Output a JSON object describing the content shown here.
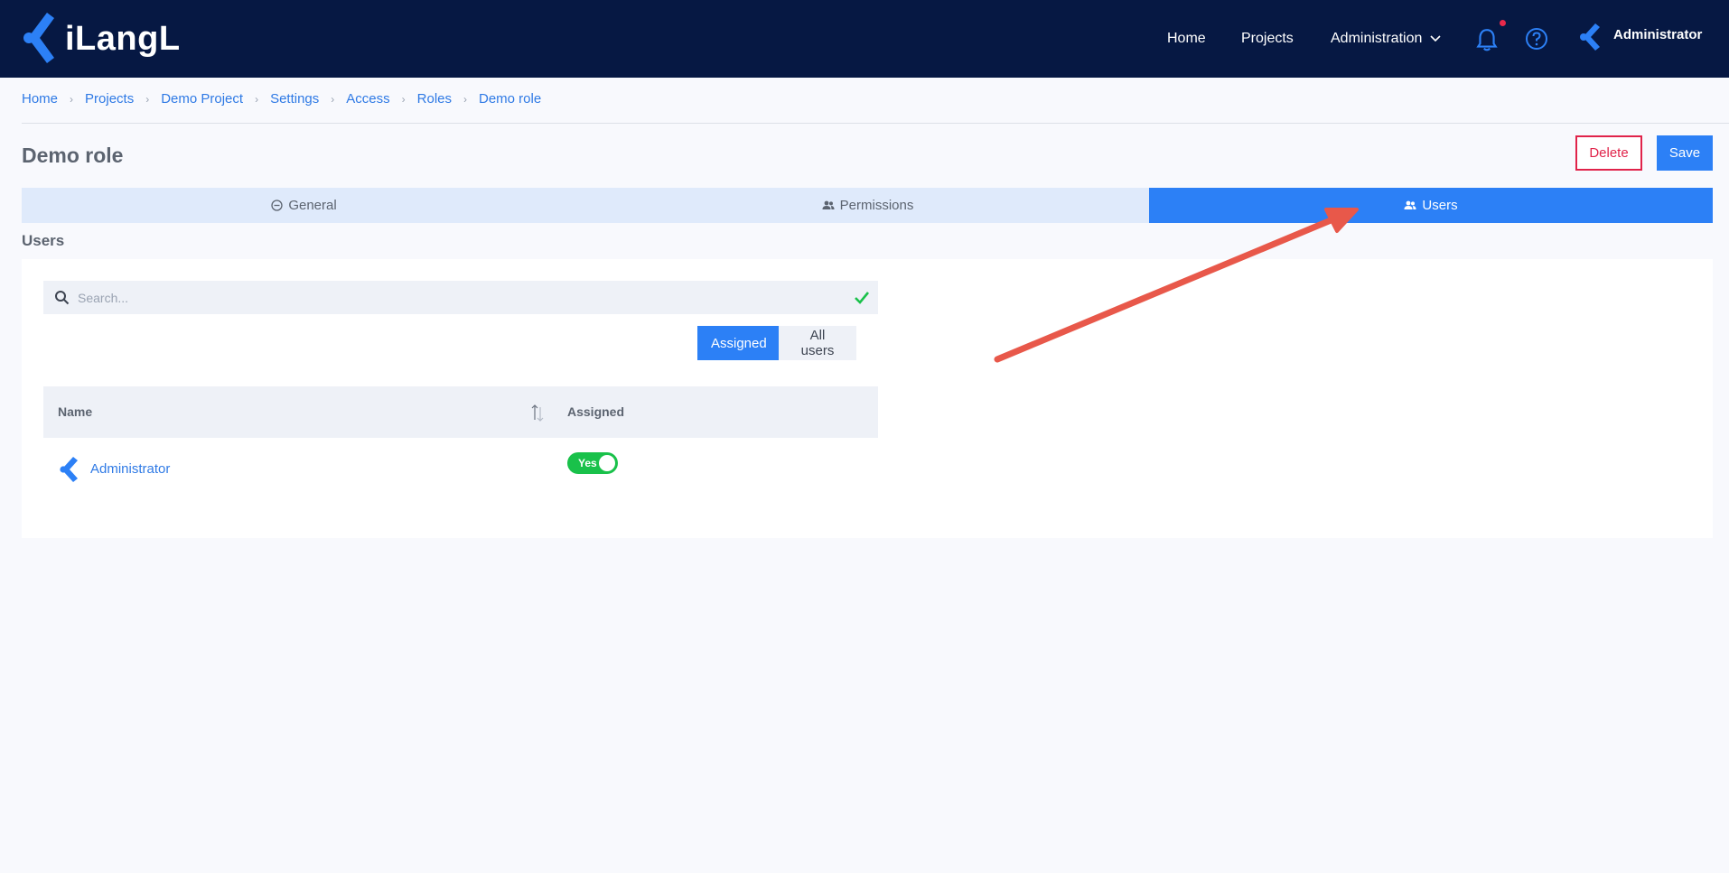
{
  "app": {
    "logo_text": "iLangL",
    "brand_color": "#2c80f6",
    "nav_bg": "#061843"
  },
  "nav": {
    "home": "Home",
    "projects": "Projects",
    "administration": "Administration",
    "user_name": "Administrator",
    "icons": [
      "bell-icon",
      "help-icon",
      "chevron-down-icon",
      "user-avatar-icon"
    ]
  },
  "breadcrumb": [
    "Home",
    "Projects",
    "Demo Project",
    "Settings",
    "Access",
    "Roles",
    "Demo role"
  ],
  "page": {
    "title": "Demo role",
    "delete_label": "Delete",
    "save_label": "Save"
  },
  "tabs": [
    {
      "label": "General",
      "icon": "minus-circle-icon",
      "active": false
    },
    {
      "label": "Permissions",
      "icon": "users-icon",
      "active": false
    },
    {
      "label": "Users",
      "icon": "users-icon",
      "active": true
    }
  ],
  "users_section": {
    "title": "Users",
    "search_placeholder": "Search...",
    "filter": {
      "assigned": "Assigned",
      "all_users": "All users",
      "selected": "Assigned"
    },
    "table": {
      "columns": [
        "Name",
        "Assigned"
      ],
      "rows": [
        {
          "name": "Administrator",
          "assigned": "Yes"
        }
      ]
    }
  },
  "annotation": {
    "color": "#e8584a"
  }
}
